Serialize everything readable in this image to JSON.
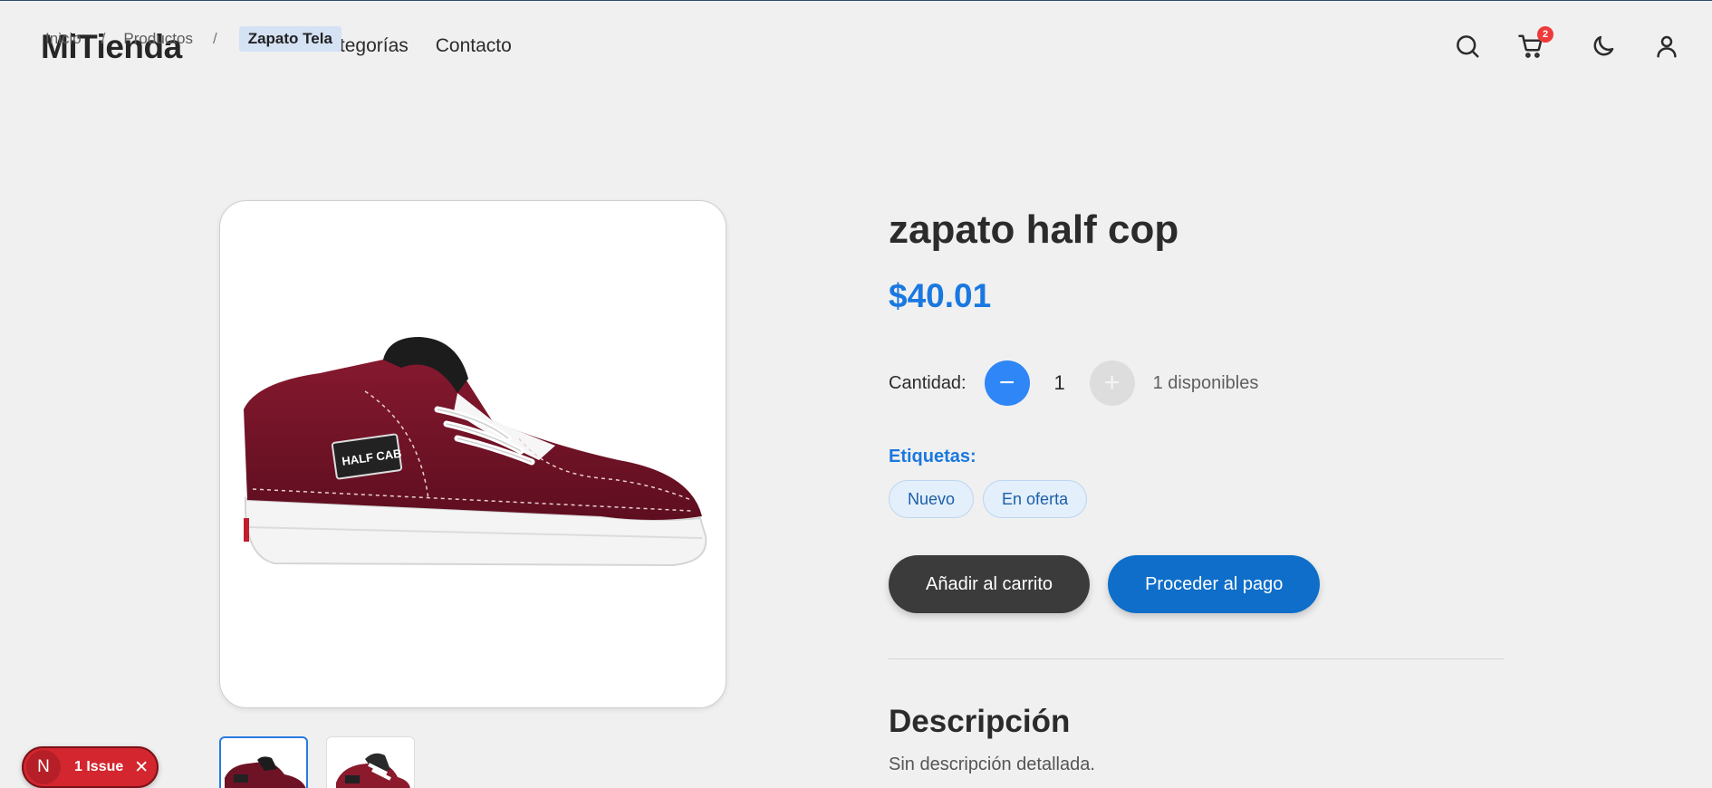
{
  "header": {
    "logo": "MiTienda",
    "nav": [
      "Inicio",
      "Categorías",
      "Contacto"
    ],
    "cart_count": "2",
    "icons": [
      "search-icon",
      "cart-icon",
      "moon-icon",
      "user-icon"
    ]
  },
  "breadcrumb": {
    "items": [
      "Inicio",
      "Productos"
    ],
    "separator": "/",
    "current": "Zapato Tela"
  },
  "product": {
    "title": "zapato half cop",
    "price": "$40.01",
    "quantity_label": "Cantidad:",
    "minus_symbol": "−",
    "quantity": "1",
    "plus_symbol": "+",
    "stock": "1 disponibles",
    "tags_label": "Etiquetas:",
    "tags": [
      "Nuevo",
      "En oferta"
    ],
    "add_to_cart": "Añadir al carrito",
    "checkout": "Proceder al pago",
    "description_title": "Descripción",
    "description": "Sin descripción detallada.",
    "patch_text": "HALF CAB"
  },
  "issue_pill": {
    "badge": "N",
    "label": "1 Issue",
    "close_symbol": "✕"
  },
  "colors": {
    "accent": "#1a78e0",
    "background": "#f0f0f0",
    "dark_button": "#3b3b3b",
    "blue_button": "#0e6ec9",
    "shoe": "#7a1228",
    "issue": "#d3262f"
  }
}
